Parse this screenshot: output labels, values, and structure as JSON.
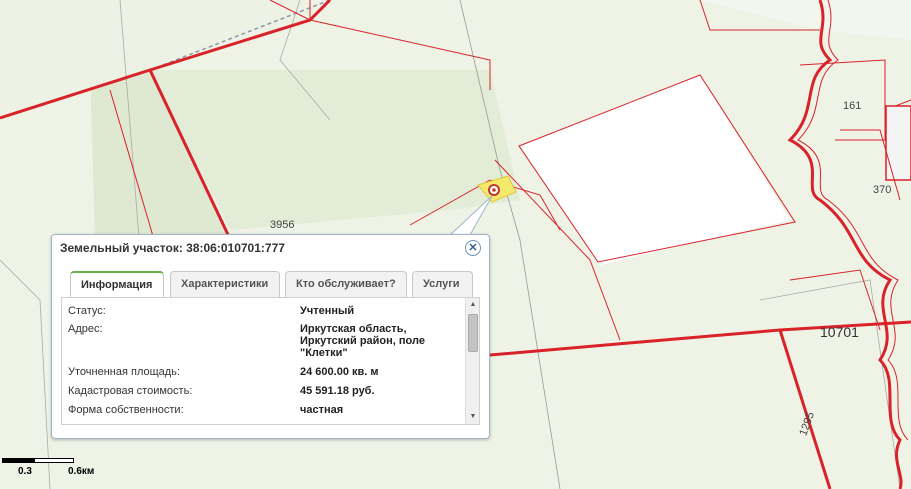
{
  "map": {
    "labels": {
      "l3956": "3956",
      "l161": "161",
      "l370": "370",
      "l10701": "10701",
      "l1295": "1295"
    }
  },
  "scale": {
    "tick_mid": "0.3",
    "tick_end": "0.6км"
  },
  "popup": {
    "title": "Земельный участок: 38:06:010701:777",
    "close_symbol": "✕",
    "tabs": [
      "Информация",
      "Характеристики",
      "Кто обслуживает?",
      "Услуги"
    ],
    "active_tab": "Информация",
    "rows": [
      {
        "key": "Статус:",
        "value": "Учтенный"
      },
      {
        "key": "Адрес:",
        "value": "Иркутская область, Иркутский район, поле \"Клетки\""
      },
      {
        "key": "Уточненная площадь:",
        "value": "24 600.00 кв. м"
      },
      {
        "key": "Кадастровая стоимость:",
        "value": "45 591.18 руб."
      },
      {
        "key": "Форма собственности:",
        "value": "частная"
      }
    ],
    "scroll_up_icon": "▲",
    "scroll_down_icon": "▼"
  },
  "colors": {
    "boundary": "#d9222a",
    "parcel_highlight": "#f5e96b",
    "accent_tab": "#6ab04c"
  }
}
